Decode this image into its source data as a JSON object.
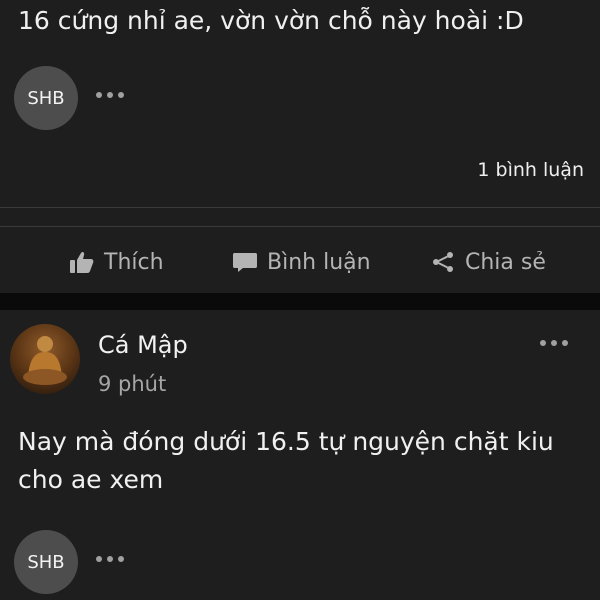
{
  "post1": {
    "text": "16 cứng nhỉ ae, vờn vờn chỗ này hoài :D",
    "avatar_text": "SHB",
    "comment_count": "1 bình luận"
  },
  "actions": {
    "like": "Thích",
    "comment": "Bình luận",
    "share": "Chia sẻ"
  },
  "post2": {
    "author": "Cá Mập",
    "time": "9 phút",
    "text": "Nay mà đóng dưới 16.5 tự nguyện chặt kiu cho ae xem",
    "avatar_text": "SHB"
  },
  "icons": {
    "like": "thumb-up-icon",
    "comment": "comment-icon",
    "share": "share-icon",
    "more": "more-icon"
  }
}
